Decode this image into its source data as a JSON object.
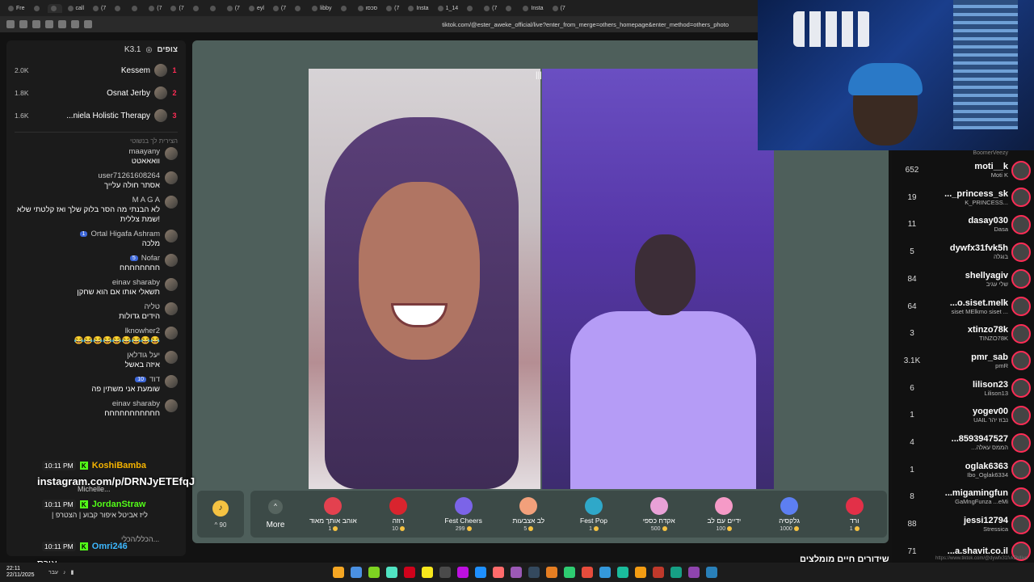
{
  "browser": {
    "tabs": [
      "Fre",
      "",
      "",
      "call",
      "(7",
      "",
      "",
      "(7",
      "(7",
      "",
      "",
      "(7",
      "eyl",
      "(7",
      "",
      "libby",
      "",
      "סכסו",
      "(7",
      "Insta",
      "1_14",
      "",
      "(7",
      "",
      "Insta",
      "(7"
    ],
    "url": "tiktok.com/@ester_aweke_official/live?enter_from_merge=others_homepage&enter_method=others_photo"
  },
  "viewers": {
    "title": "צופים",
    "count": "K3.1",
    "top": [
      {
        "rank": "1",
        "name": "Kessem",
        "score": "2.0K"
      },
      {
        "rank": "2",
        "name": "Osnat Jerby",
        "score": "1.8K"
      },
      {
        "rank": "3",
        "name": "...niela Holistic Therapy",
        "score": "1.6K"
      }
    ]
  },
  "chat": {
    "faded": "הצירית לך בנשוטי",
    "messages": [
      {
        "user": "maayany",
        "text": "וואאאטט",
        "badge": ""
      },
      {
        "user": "user71261608264",
        "text": "אסתר חולה עלייך",
        "badge": ""
      },
      {
        "user": "M A G A",
        "text": "לא הבנתי מה הסר בלוק שלך ואז קלטתי שלא שמת צללית!",
        "badge": ""
      },
      {
        "user": "Ortal Higafa Ashram",
        "text": "מלכה",
        "badge": "1"
      },
      {
        "user": "Nofar",
        "text": "חחחחחחחח",
        "badge": "5"
      },
      {
        "user": "einav sharaby",
        "text": "תשאלי אותו אם הוא שחקן",
        "badge": ""
      },
      {
        "user": "טליה",
        "text": "הידים גדולות",
        "badge": ""
      },
      {
        "user": "lknowher2",
        "text": "😂😂😂😂😂😂😂😂😂",
        "badge": ""
      },
      {
        "user": "יעל גודלאן",
        "text": "איזה באשל",
        "badge": ""
      },
      {
        "user": "דוד",
        "text": "שומעת אני משתין פה",
        "badge": "10"
      },
      {
        "user": "einav sharaby",
        "text": "חחחחחחחחחחח",
        "badge": ""
      }
    ]
  },
  "overlay": {
    "kick_lines": [
      {
        "time": "10:11 PM",
        "name": "KoshiBamba",
        "color": "#f5b300"
      },
      {
        "time": "10:11 PM",
        "name": "JordanStraw",
        "color": "#53fc18"
      },
      {
        "time": "10:11 PM",
        "name": "Omri246",
        "color": "#3db8ff"
      }
    ],
    "instagram": "instagram.com/p/DRNJyETEfqJ",
    "cropped_user": "Michelle...",
    "cropped_text": "| ליז אביטל איפור קבוע | הצטרפ",
    "cropped_hint": "הכלל/הכלי...",
    "small_text": "איכס"
  },
  "stage": {
    "divider_icon": "pause-bars"
  },
  "gifts": {
    "coins": "90",
    "more_label": "More",
    "items": [
      {
        "name": "אוהב אותך מאוד",
        "price": "1",
        "color": "#e3414f"
      },
      {
        "name": "רוזה",
        "price": "10",
        "color": "#d9242e"
      },
      {
        "name": "Fest Cheers",
        "price": "299",
        "color": "#7b64e8"
      },
      {
        "name": "לב אצבעות",
        "price": "5",
        "color": "#f2a07b"
      },
      {
        "name": "Fest Pop",
        "price": "1",
        "color": "#2fa8c9"
      },
      {
        "name": "אקדח כספי",
        "price": "500",
        "color": "#e9a1d7"
      },
      {
        "name": "ידיים עם לב",
        "price": "100",
        "color": "#f59ac7"
      },
      {
        "name": "גלקסיה",
        "price": "1000",
        "color": "#5d7ff2"
      },
      {
        "name": "ורד",
        "price": "1",
        "color": "#e23048"
      }
    ]
  },
  "leaderboard": {
    "cropped_top": "BoomerVeezy",
    "rows": [
      {
        "score": "652",
        "name": "moti__k",
        "sub": "Moti K"
      },
      {
        "score": "19",
        "name": "..._princess_sk",
        "sub": "K_PRINCESS..."
      },
      {
        "score": "11",
        "name": "dasay030",
        "sub": "Dasa"
      },
      {
        "score": "5",
        "name": "dywfx31fvk5h",
        "sub": "בוגלה"
      },
      {
        "score": "84",
        "name": "shellyagiv",
        "sub": "שלי עגיב"
      },
      {
        "score": "64",
        "name": "...o.siset.melk",
        "sub": "siset MElkmo siset ..."
      },
      {
        "score": "3",
        "name": "xtinzo78k",
        "sub": "TINZO78K"
      },
      {
        "score": "3.1K",
        "name": "pmr_sab",
        "sub": "pmR"
      },
      {
        "score": "6",
        "name": "lilison23",
        "sub": "Lilison13"
      },
      {
        "score": "1",
        "name": "yogev00",
        "sub": "UAIL נבוז יהר"
      },
      {
        "score": "4",
        "name": "...8593947527",
        "sub": "...הממס עאלה"
      },
      {
        "score": "1",
        "name": "oglak6363",
        "sub": "Ibo_Oglak6334"
      },
      {
        "score": "8",
        "name": "...migamingfun",
        "sub": "GaMngFunza ...eMi"
      },
      {
        "score": "88",
        "name": "jessi12794",
        "sub": "Stressica"
      },
      {
        "score": "71",
        "name": "...a.shavit.co.il",
        "sub": ""
      }
    ]
  },
  "bottom_heading": "שידורים חיים מומלצים",
  "url_hint": "https://www.tiktok.com/@dywfx31fvk5h/live",
  "taskbar": {
    "time": "22:11",
    "date": "22/11/2025",
    "lang": "עבר"
  }
}
